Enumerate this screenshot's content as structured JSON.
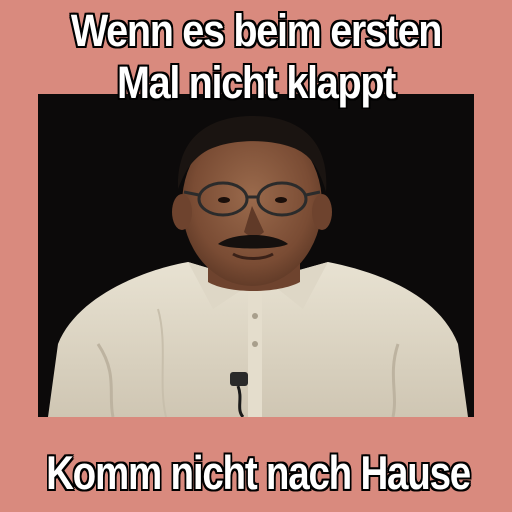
{
  "meme": {
    "top_text_line1": "Wenn es beim ersten",
    "top_text_line2": "Mal nicht klappt",
    "bottom_text": "Komm nicht nach Hause",
    "background_color": "#d98a7e",
    "photo_background_color": "#0c0a0a",
    "text_color": "#ffffff",
    "text_outline_color": "#000000"
  }
}
